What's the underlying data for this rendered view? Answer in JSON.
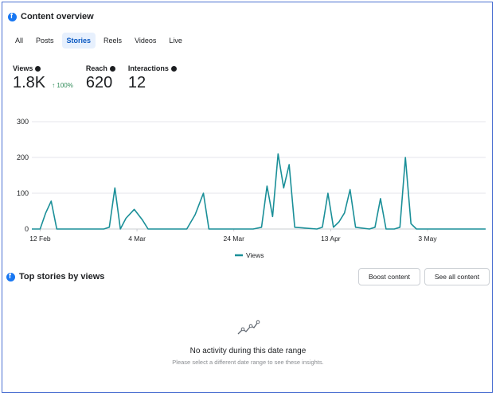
{
  "overview": {
    "title": "Content overview"
  },
  "tabs": [
    {
      "label": "All",
      "active": false
    },
    {
      "label": "Posts",
      "active": false
    },
    {
      "label": "Stories",
      "active": true
    },
    {
      "label": "Reels",
      "active": false
    },
    {
      "label": "Videos",
      "active": false
    },
    {
      "label": "Live",
      "active": false
    }
  ],
  "metrics": {
    "views": {
      "label": "Views",
      "value": "1.8K",
      "change": "↑ 100%"
    },
    "reach": {
      "label": "Reach",
      "value": "620"
    },
    "interactions": {
      "label": "Interactions",
      "value": "12"
    }
  },
  "chart_data": {
    "type": "line",
    "title": "",
    "xlabel": "",
    "ylabel": "",
    "ylim": [
      0,
      300
    ],
    "y_ticks": [
      "300",
      "200",
      "100",
      "0"
    ],
    "x_tick_labels": [
      "12 Feb",
      "4 Mar",
      "24 Mar",
      "13 Apr",
      "3 May"
    ],
    "grid": true,
    "legend": "bottom-center",
    "series": [
      {
        "name": "Views",
        "color": "#1a8f98",
        "points": [
          [
            0,
            0
          ],
          [
            3,
            0
          ],
          [
            5,
            45
          ],
          [
            7,
            78
          ],
          [
            9,
            0
          ],
          [
            26,
            0
          ],
          [
            28,
            5
          ],
          [
            30,
            115
          ],
          [
            32,
            0
          ],
          [
            34,
            30
          ],
          [
            37,
            55
          ],
          [
            40,
            25
          ],
          [
            42,
            0
          ],
          [
            56,
            0
          ],
          [
            59,
            40
          ],
          [
            62,
            100
          ],
          [
            64,
            0
          ],
          [
            80,
            0
          ],
          [
            83,
            5
          ],
          [
            85,
            120
          ],
          [
            87,
            35
          ],
          [
            89,
            210
          ],
          [
            91,
            115
          ],
          [
            93,
            180
          ],
          [
            95,
            5
          ],
          [
            103,
            0
          ],
          [
            105,
            5
          ],
          [
            107,
            100
          ],
          [
            109,
            5
          ],
          [
            111,
            20
          ],
          [
            113,
            45
          ],
          [
            115,
            110
          ],
          [
            117,
            5
          ],
          [
            122,
            0
          ],
          [
            124,
            5
          ],
          [
            126,
            85
          ],
          [
            128,
            0
          ],
          [
            131,
            0
          ],
          [
            133,
            5
          ],
          [
            135,
            200
          ],
          [
            137,
            15
          ],
          [
            139,
            0
          ],
          [
            164,
            0
          ]
        ]
      }
    ]
  },
  "stories": {
    "title": "Top stories by views",
    "boost_label": "Boost content",
    "see_all_label": "See all content",
    "empty_title": "No activity during this date range",
    "empty_subtitle": "Please select a different date range to see these insights."
  }
}
